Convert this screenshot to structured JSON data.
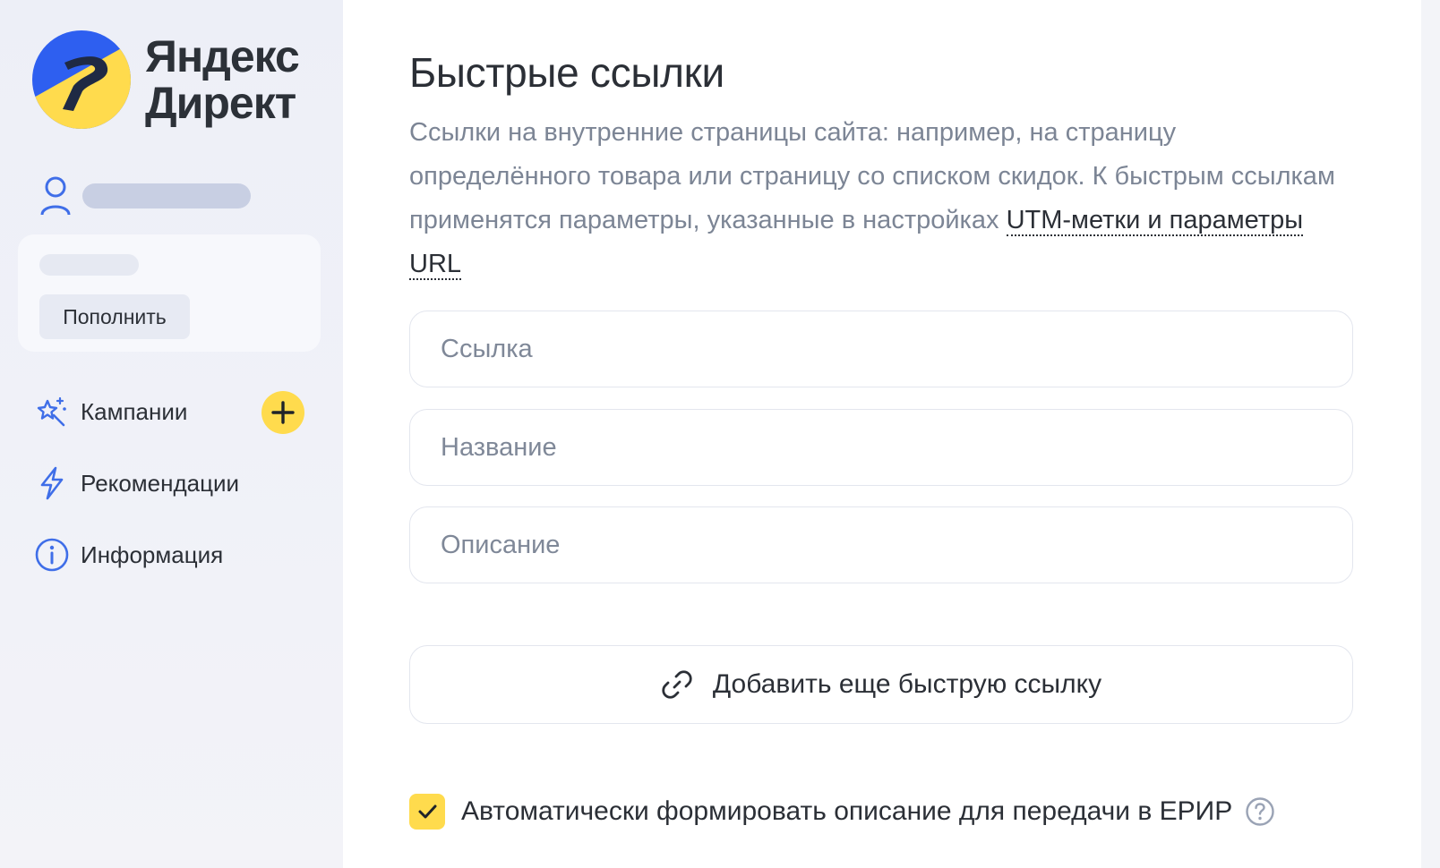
{
  "brand": {
    "line1": "Яндекс",
    "line2": "Директ"
  },
  "sidebar": {
    "topup_label": "Пополнить",
    "nav": [
      {
        "label": "Кампании",
        "icon": "sparkle-wand-icon"
      },
      {
        "label": "Рекомендации",
        "icon": "lightning-icon"
      },
      {
        "label": "Информация",
        "icon": "info-icon"
      }
    ]
  },
  "section": {
    "title": "Быстрые ссылки",
    "description": "Ссылки на внутренние страницы сайта: например, на страницу определённого товара или страницу со списком скидок. К быстрым ссылкам применятся параметры, указанные в настройках ",
    "description_link": "UTM-метки и параметры URL"
  },
  "fields": {
    "link_placeholder": "Ссылка",
    "name_placeholder": "Название",
    "description_placeholder": "Описание"
  },
  "add_link_label": "Добавить еще быструю ссылку",
  "erir": {
    "label": "Автоматически формировать описание для передачи в ЕРИР",
    "checked": true
  },
  "colors": {
    "accent_yellow": "#ffdb4d",
    "brand_blue": "#2e5ff0",
    "icon_blue": "#3f6ee8",
    "text": "#2b2f36",
    "muted_text": "#7c8595"
  }
}
